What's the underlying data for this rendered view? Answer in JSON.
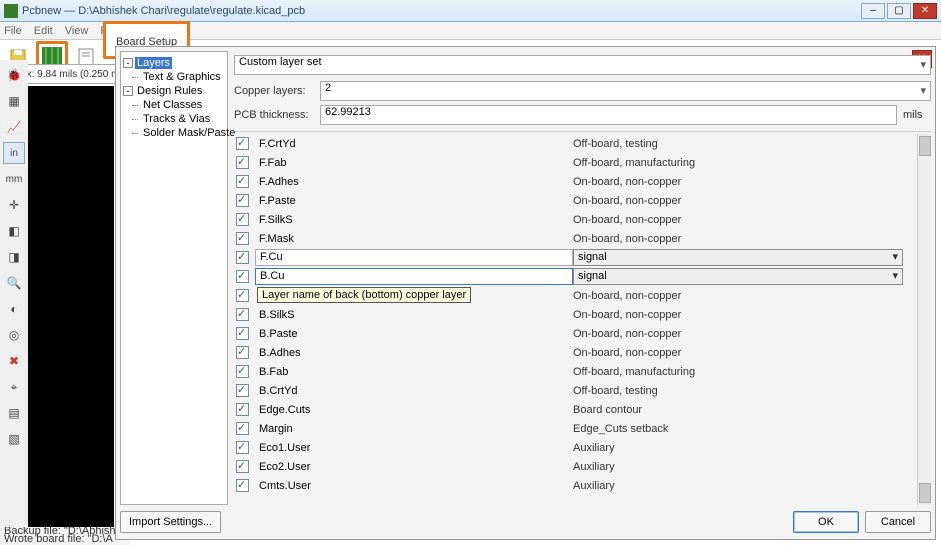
{
  "window": {
    "title": "Pcbnew — D:\\Abhishek Chari\\regulate\\regulate.kicad_pcb"
  },
  "menubar": {
    "items": [
      "File",
      "Edit",
      "View",
      "Pl…"
    ]
  },
  "toolbar": {
    "board_setup_label": "Board Setup"
  },
  "track_info": "Track: 9.84 mils (0.250 m",
  "statusbar": {
    "line1": "Backup file: \"D:\\Abhish",
    "line2": "Wrote board file: \"D:\\A"
  },
  "dialog": {
    "tree": {
      "layers": "Layers",
      "text_graphics": "Text & Graphics",
      "design_rules": "Design Rules",
      "net_classes": "Net Classes",
      "tracks_vias": "Tracks & Vias",
      "solder_mask": "Solder Mask/Paste"
    },
    "preset": "Custom layer set",
    "copper_label": "Copper layers:",
    "copper_value": "2",
    "thickness_label": "PCB thickness:",
    "thickness_value": "62.99213",
    "thickness_units": "mils",
    "tooltip": "Layer name of back (bottom) copper layer",
    "signal_label": "signal",
    "layers": [
      {
        "name": "F.CrtYd",
        "desc": "Off-board, testing"
      },
      {
        "name": "F.Fab",
        "desc": "Off-board, manufacturing"
      },
      {
        "name": "F.Adhes",
        "desc": "On-board, non-copper"
      },
      {
        "name": "F.Paste",
        "desc": "On-board, non-copper"
      },
      {
        "name": "F.SilkS",
        "desc": "On-board, non-copper"
      },
      {
        "name": "F.Mask",
        "desc": "On-board, non-copper"
      },
      {
        "name": "F.Cu",
        "desc": "",
        "editable": true,
        "type": true
      },
      {
        "name": "B.Cu",
        "desc": "",
        "editable": true,
        "type": true,
        "focused": true
      },
      {
        "name": "",
        "desc": "On-board, non-copper",
        "hidden_name": true
      },
      {
        "name": "B.SilkS",
        "desc": "On-board, non-copper"
      },
      {
        "name": "B.Paste",
        "desc": "On-board, non-copper"
      },
      {
        "name": "B.Adhes",
        "desc": "On-board, non-copper"
      },
      {
        "name": "B.Fab",
        "desc": "Off-board, manufacturing"
      },
      {
        "name": "B.CrtYd",
        "desc": "Off-board, testing"
      },
      {
        "name": "Edge.Cuts",
        "desc": "Board contour"
      },
      {
        "name": "Margin",
        "desc": "Edge_Cuts setback"
      },
      {
        "name": "Eco1.User",
        "desc": "Auxiliary"
      },
      {
        "name": "Eco2.User",
        "desc": "Auxiliary"
      },
      {
        "name": "Cmts.User",
        "desc": "Auxiliary"
      }
    ],
    "buttons": {
      "import": "Import Settings...",
      "ok": "OK",
      "cancel": "Cancel"
    }
  },
  "rail_icons": [
    "bug",
    "grid",
    "chart",
    "in",
    "mm",
    "plus",
    "pad1",
    "pad2",
    "zoom",
    "drc",
    "via",
    "ex",
    "ratsnest",
    "layers",
    "fill"
  ]
}
